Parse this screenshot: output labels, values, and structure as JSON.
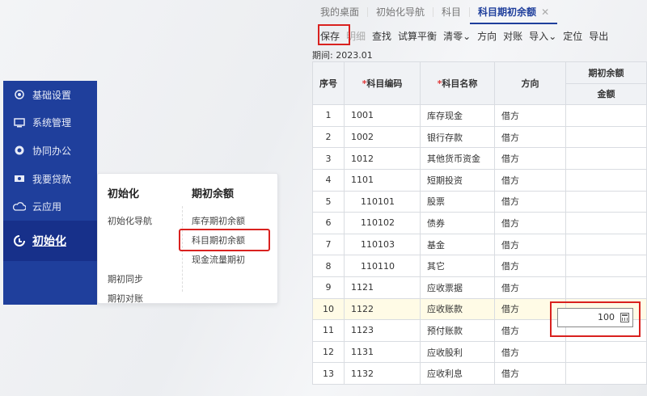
{
  "sidebar": {
    "items": [
      {
        "label": "基础设置",
        "icon": "settings-icon"
      },
      {
        "label": "系统管理",
        "icon": "monitor-icon"
      },
      {
        "label": "协同办公",
        "icon": "collab-icon"
      },
      {
        "label": "我要贷款",
        "icon": "loan-icon"
      },
      {
        "label": "云应用",
        "icon": "cloud-icon"
      },
      {
        "label": "初始化",
        "icon": "init-icon"
      }
    ]
  },
  "submenu": {
    "col1": {
      "heading": "初始化",
      "items": [
        "初始化导航",
        "期初同步",
        "期初对账"
      ]
    },
    "col2": {
      "heading": "期初余额",
      "items": [
        "库存期初余额",
        "科目期初余额",
        "现金流量期初"
      ]
    }
  },
  "tabs": [
    {
      "label": "我的桌面"
    },
    {
      "label": "初始化导航"
    },
    {
      "label": "科目"
    },
    {
      "label": "科目期初余额",
      "close": "✕"
    }
  ],
  "toolbar": [
    "保存",
    "明细",
    "查找",
    "试算平衡",
    "清零",
    "方向",
    "对账",
    "导入",
    "定位",
    "导出"
  ],
  "period": "期间: 2023.01",
  "table": {
    "headers": {
      "no": "序号",
      "code": "科目编码",
      "name": "科目名称",
      "dir": "方向",
      "group": "期初余额",
      "amount": "金额",
      "required_mark": "*"
    },
    "rows": [
      {
        "no": "1",
        "code": "1001",
        "name": "库存现金",
        "dir": "借方"
      },
      {
        "no": "2",
        "code": "1002",
        "name": "银行存款",
        "dir": "借方"
      },
      {
        "no": "3",
        "code": "1012",
        "name": "其他货币资金",
        "dir": "借方"
      },
      {
        "no": "4",
        "code": "1101",
        "name": "短期投资",
        "dir": "借方"
      },
      {
        "no": "5",
        "code": "110101",
        "name": "股票",
        "dir": "借方"
      },
      {
        "no": "6",
        "code": "110102",
        "name": "债券",
        "dir": "借方"
      },
      {
        "no": "7",
        "code": "110103",
        "name": "基金",
        "dir": "借方"
      },
      {
        "no": "8",
        "code": "110110",
        "name": "其它",
        "dir": "借方"
      },
      {
        "no": "9",
        "code": "1121",
        "name": "应收票据",
        "dir": "借方"
      },
      {
        "no": "10",
        "code": "1122",
        "name": "应收账款",
        "dir": "借方"
      },
      {
        "no": "11",
        "code": "1123",
        "name": "预付账款",
        "dir": "借方"
      },
      {
        "no": "12",
        "code": "1131",
        "name": "应收股利",
        "dir": "借方"
      },
      {
        "no": "13",
        "code": "1132",
        "name": "应收利息",
        "dir": "借方"
      }
    ],
    "amount_input_value": "100"
  },
  "colors": {
    "sidebar_bg": "#1f3f9c",
    "highlight_red": "#d9211f",
    "selected_row": "#fffbe6"
  }
}
